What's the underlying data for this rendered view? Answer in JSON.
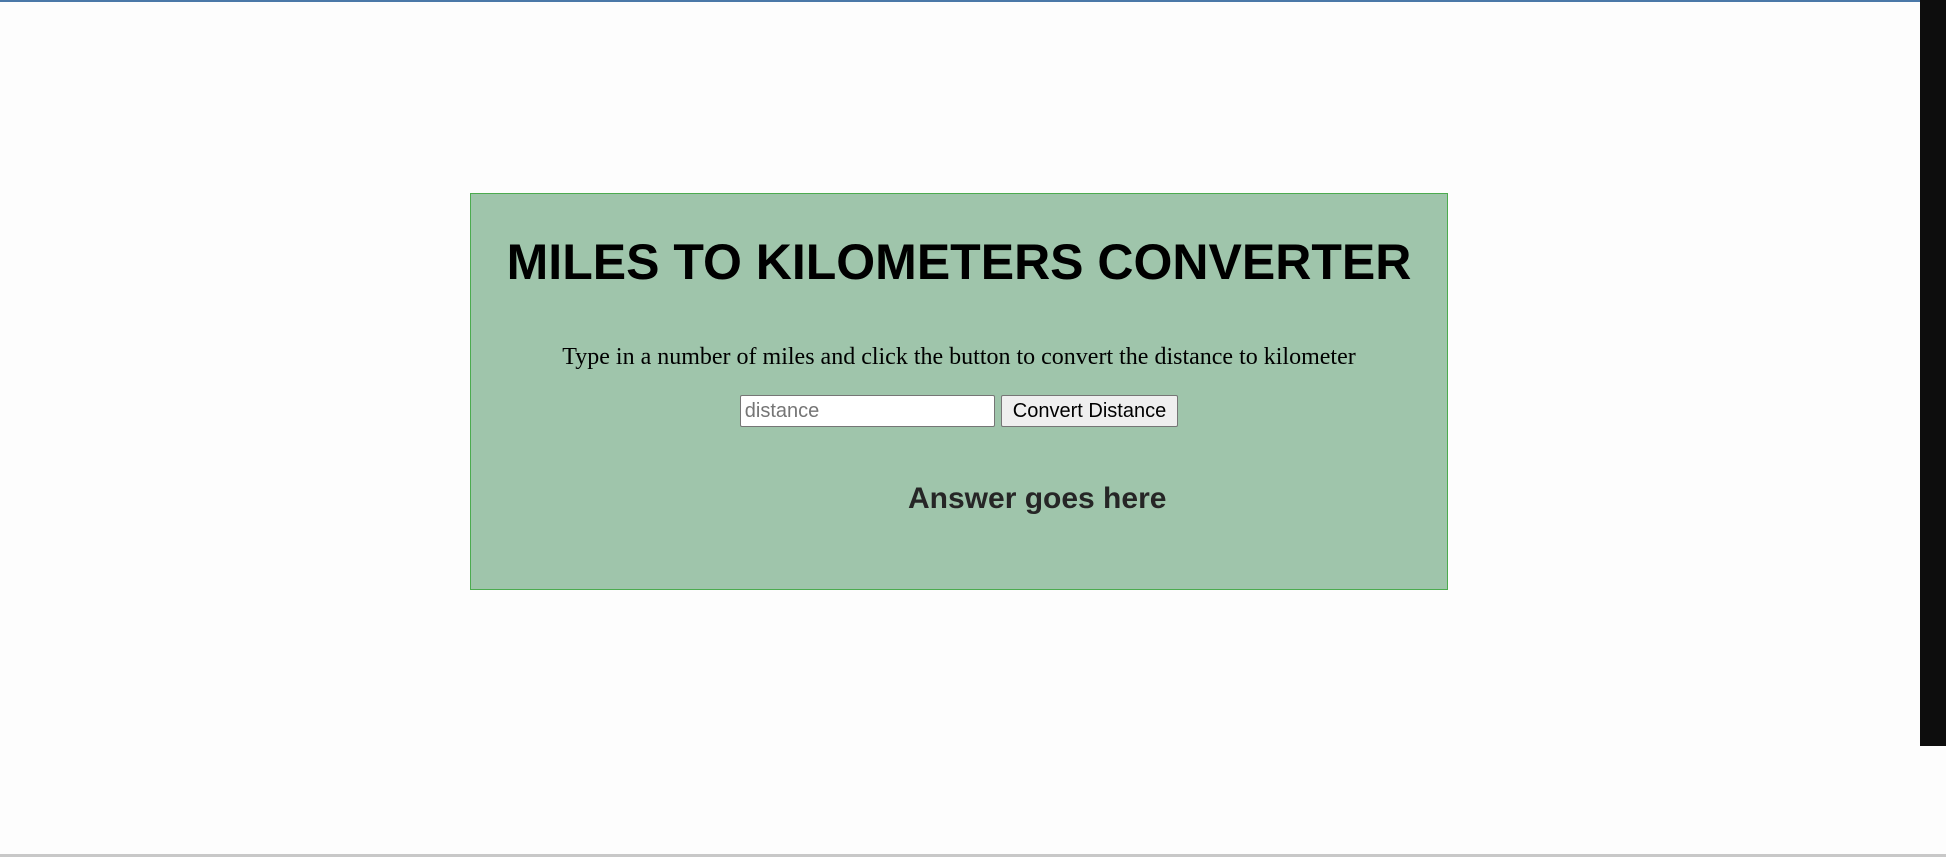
{
  "converter": {
    "title": "MILES TO KILOMETERS CONVERTER",
    "instructions": "Type in a number of miles and click the button to convert the distance to kilometer",
    "input_placeholder": "distance",
    "input_value": "",
    "button_label": "Convert Distance",
    "answer_text": "Answer goes here"
  },
  "colors": {
    "card_background": "#9fc5ab",
    "card_border": "#4cab4f",
    "page_background": "#fdfdfd"
  }
}
